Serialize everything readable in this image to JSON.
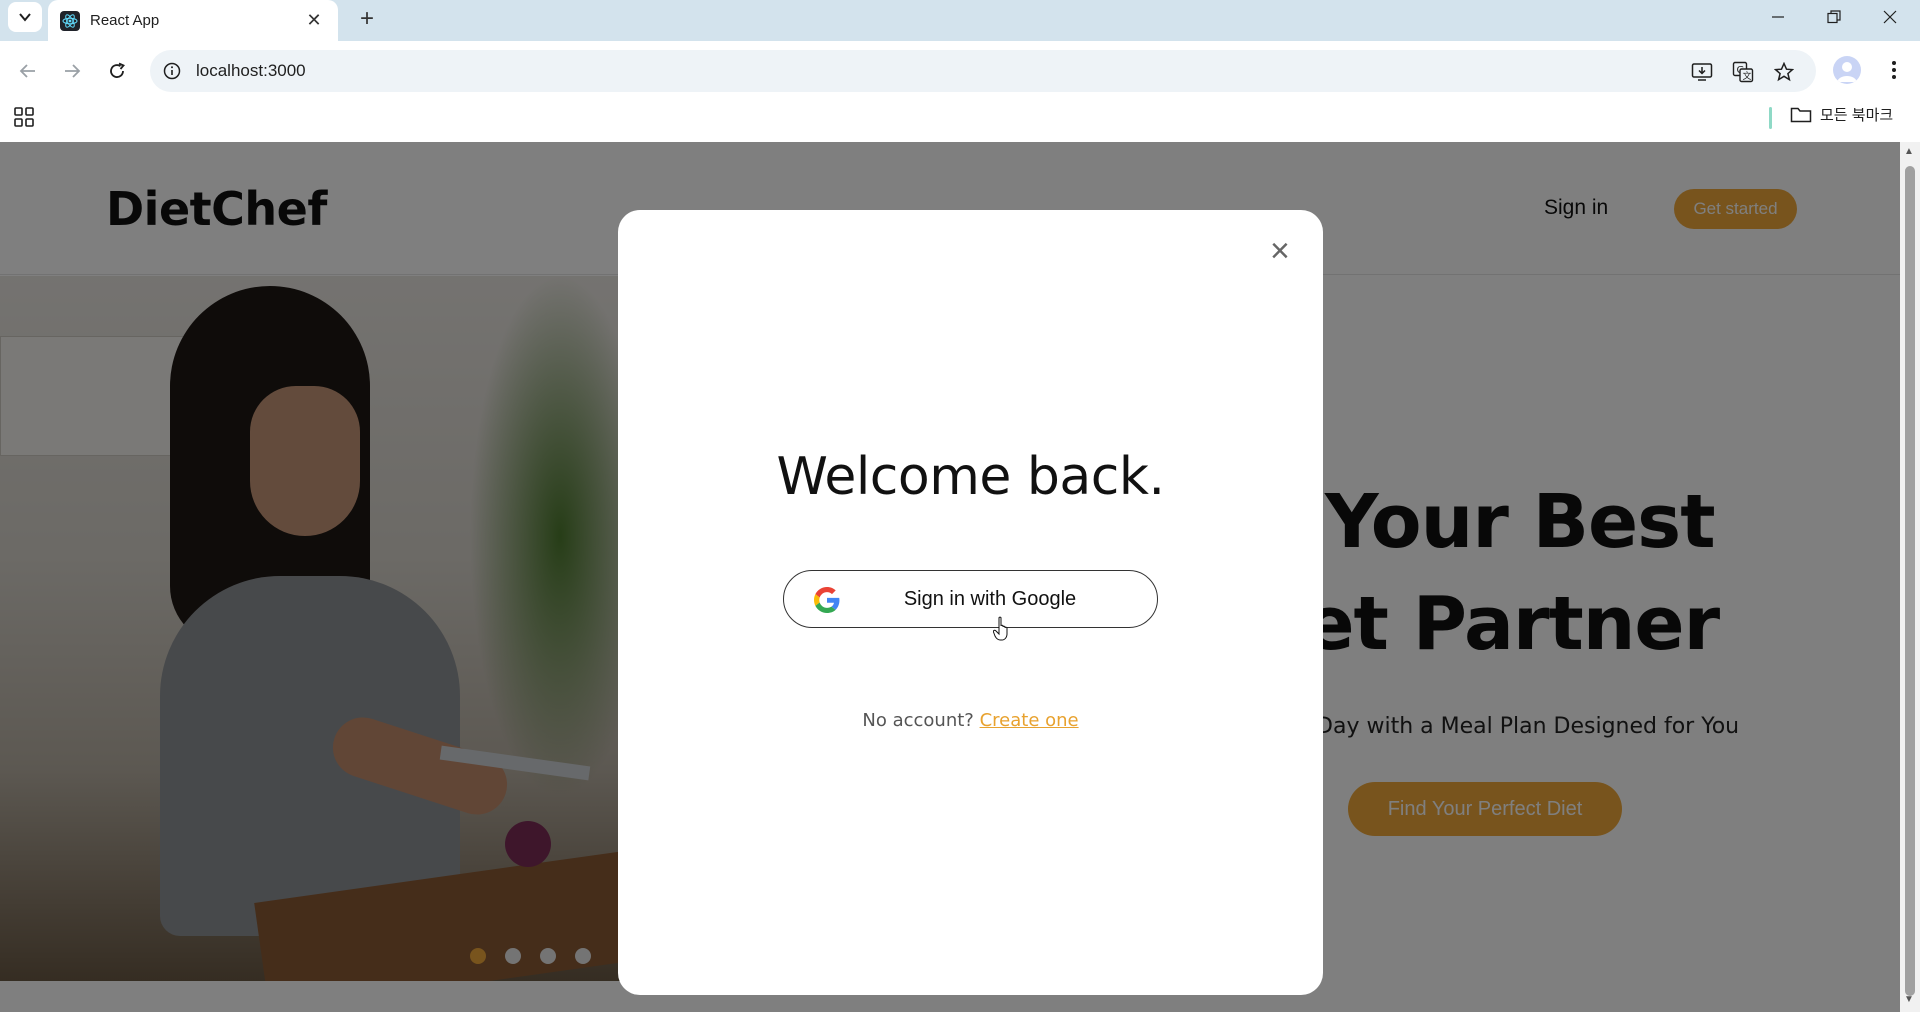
{
  "browser": {
    "tab_title": "React App",
    "url": "localhost:3000",
    "bookmark_folder_label": "모든 북마크"
  },
  "site": {
    "logo": "DietChef",
    "nav_signin": "Sign in",
    "get_started": "Get started",
    "hero_title_line1": "Your Best",
    "hero_title_line2": "iet Partner",
    "hero_subtitle": "r Day with a Meal Plan Designed for You",
    "hero_cta": "Find Your Perfect Diet",
    "carousel": {
      "slides": 4,
      "active_index": 0
    }
  },
  "modal": {
    "title": "Welcome back.",
    "google_button": "Sign in with Google",
    "no_account_text": "No account?",
    "create_link": "Create one",
    "close_symbol": "×"
  },
  "colors": {
    "accent": "#f0a93a",
    "overlay": "rgba(0,0,0,0.5)",
    "tabstrip": "#d3e3ed"
  }
}
